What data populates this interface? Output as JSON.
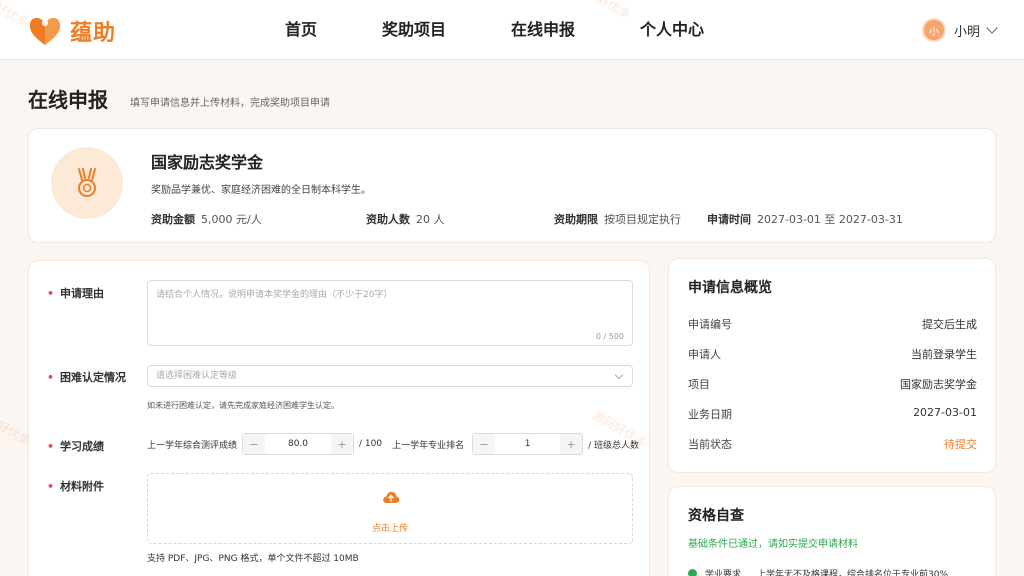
{
  "header": {
    "brand": "蕴助",
    "nav": [
      "首页",
      "奖助项目",
      "在线申报",
      "个人中心"
    ],
    "user": {
      "avatar_text": "小",
      "name": "小明"
    }
  },
  "page": {
    "title": "在线申报",
    "subtitle": "填写申请信息并上传材料，完成奖助项目申请"
  },
  "project": {
    "name": "国家励志奖学金",
    "desc": "奖励品学兼优、家庭经济困难的全日制本科学生。",
    "meta": [
      {
        "key": "资助金额",
        "value": "5,000 元/人"
      },
      {
        "key": "资助人数",
        "value": "20 人"
      },
      {
        "key": "资助期限",
        "value": "按项目规定执行"
      },
      {
        "key": "申请时间",
        "value": "2027-03-01 至 2027-03-31"
      }
    ]
  },
  "form": {
    "reason_label": "申请理由",
    "reason_placeholder": "请结合个人情况，说明申请本奖学金的理由（不少于20字）",
    "reason_counter": "0 / 500",
    "difficulty_label": "困难认定情况",
    "difficulty_placeholder": "请选择困难认定等级",
    "difficulty_hint": "如未进行困难认定，请先完成家庭经济困难学生认定。",
    "score_label": "学习成绩",
    "score_text1": "上一学年综合测评成绩",
    "score_value1": "80.0",
    "score_suffix1": "/ 100",
    "score_text2": "上一学年专业排名",
    "score_value2": "1",
    "score_suffix2": "/ 班级总人数",
    "minus": "−",
    "plus": "+",
    "attach_label": "材料附件",
    "upload_text": "点击上传",
    "upload_hint": "支持 PDF、JPG、PNG 格式，单个文件不超过 10MB"
  },
  "overview": {
    "title": "申请信息概览",
    "rows": [
      {
        "key": "申请编号",
        "value": "提交后生成"
      },
      {
        "key": "申请人",
        "value": "当前登录学生"
      },
      {
        "key": "项目",
        "value": "国家励志奖学金"
      },
      {
        "key": "业务日期",
        "value": "2027-03-01"
      },
      {
        "key": "当前状态",
        "value": "待提交"
      }
    ]
  },
  "qualification": {
    "title": "资格自查",
    "ok_text": "基础条件已通过，请如实提交申请材料",
    "item_key": "学业要求",
    "item_value": "上学年无不及格课程，综合排名位于专业前30%"
  },
  "watermark": {
    "text1": "源码好优多",
    "text2": "好优多"
  },
  "colors": {
    "accent": "#f07d24",
    "success": "#2fa84f",
    "required": "#e5484d"
  }
}
